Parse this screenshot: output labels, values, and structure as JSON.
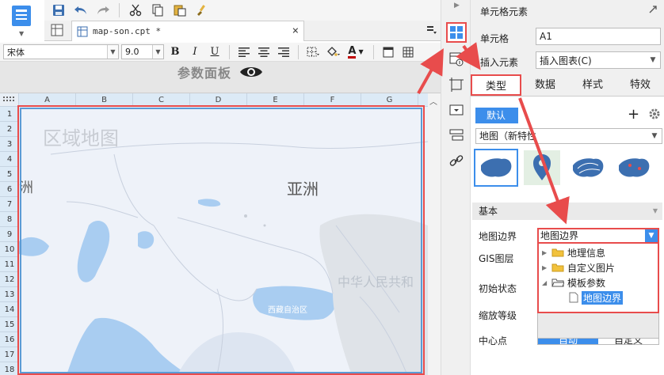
{
  "toolbar": {
    "icons": [
      "save-icon",
      "undo-icon",
      "redo-icon",
      "cut-icon",
      "copy-icon",
      "paste-icon",
      "format-painter-icon"
    ]
  },
  "tab": {
    "filename": "map-son.cpt *",
    "close": "×"
  },
  "format_bar": {
    "font": "宋体",
    "size": "9.0",
    "bold": "B",
    "italic": "I",
    "underline": "U",
    "text_color_glyph": "A"
  },
  "param_panel": {
    "title": "参数面板"
  },
  "sheet": {
    "columns": [
      "A",
      "B",
      "C",
      "D",
      "E",
      "F",
      "G"
    ],
    "rows": [
      "1",
      "2",
      "3",
      "4",
      "5",
      "6",
      "7",
      "8",
      "9",
      "10",
      "11",
      "12",
      "13",
      "14",
      "15",
      "16",
      "17",
      "18"
    ],
    "map": {
      "title": "区域地图",
      "asia_label": "亚洲",
      "china_label": "中华人民共和",
      "xizang_label": "西藏自治区",
      "edge_char": "洲"
    }
  },
  "right_panel": {
    "title": "单元格元素",
    "cell_label": "单元格",
    "cell_value": "A1",
    "insert_label": "插入元素",
    "insert_value": "插入图表(C)",
    "tabs": [
      "类型",
      "数据",
      "样式",
      "特效"
    ],
    "default_btn": "默认",
    "add": "+",
    "chart_select": "地图（新特性",
    "basic_section": "基本",
    "boundary_label": "地图边界",
    "boundary_value": "地图边界",
    "gis_label": "GIS图层",
    "init_state_label": "初始状态",
    "zoom_label": "缩放等级",
    "center_label": "中心点",
    "center_auto": "自动",
    "center_custom": "自定义",
    "tree": {
      "item1": "地理信息",
      "item2": "自定义图片",
      "item3": "模板参数",
      "item3_child": "地图边界"
    }
  },
  "colors": {
    "accent_blue": "#3c8eeb",
    "highlight_red": "#e84c4c",
    "header_blue": "#dceaf6",
    "map_water": "#a9cdf1",
    "map_land": "#e9eef7"
  }
}
